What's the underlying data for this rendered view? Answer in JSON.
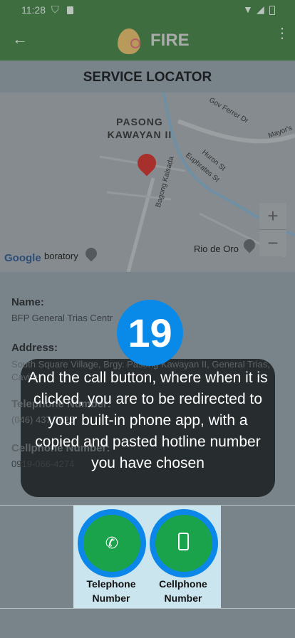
{
  "status": {
    "time": "11:28"
  },
  "appbar": {
    "title": "FIRE"
  },
  "page": {
    "title": "SERVICE LOCATOR"
  },
  "map": {
    "area": "PASONG KAWAYAN II",
    "roads": [
      "Gov Ferrer Dr",
      "Mayor's",
      "Huron St",
      "Euphrates St",
      "Bagong Kalsada"
    ],
    "place": "Rio de Oro",
    "poi": "boratory",
    "brand": "Google",
    "zoom_in": "+",
    "zoom_out": "−"
  },
  "details": {
    "name_label": "Name:",
    "name": "BFP General Trias Centr",
    "address_label": "Address:",
    "address": "South Square Village, Brgy. Pasong Kawayan II, General Trias, Cavite",
    "tel_label": "Telephone Number:",
    "tel": "(046) 437 7625",
    "cell_label": "Cellphone Number:",
    "cell": "0919-066-4274"
  },
  "buttons": {
    "telephone": "Telephone Number",
    "cellphone": "Cellphone Number"
  },
  "tutorial": {
    "step": "19",
    "text": "And the call button, where when it is clicked, you are to be redirected to your built-in phone app, with a copied and pasted hotline number you have chosen"
  },
  "colors": {
    "appbar": "#3e6e40",
    "call_button": "#1aa34a",
    "call_ring": "#0b87ea",
    "badge": "#0a8ae8"
  }
}
